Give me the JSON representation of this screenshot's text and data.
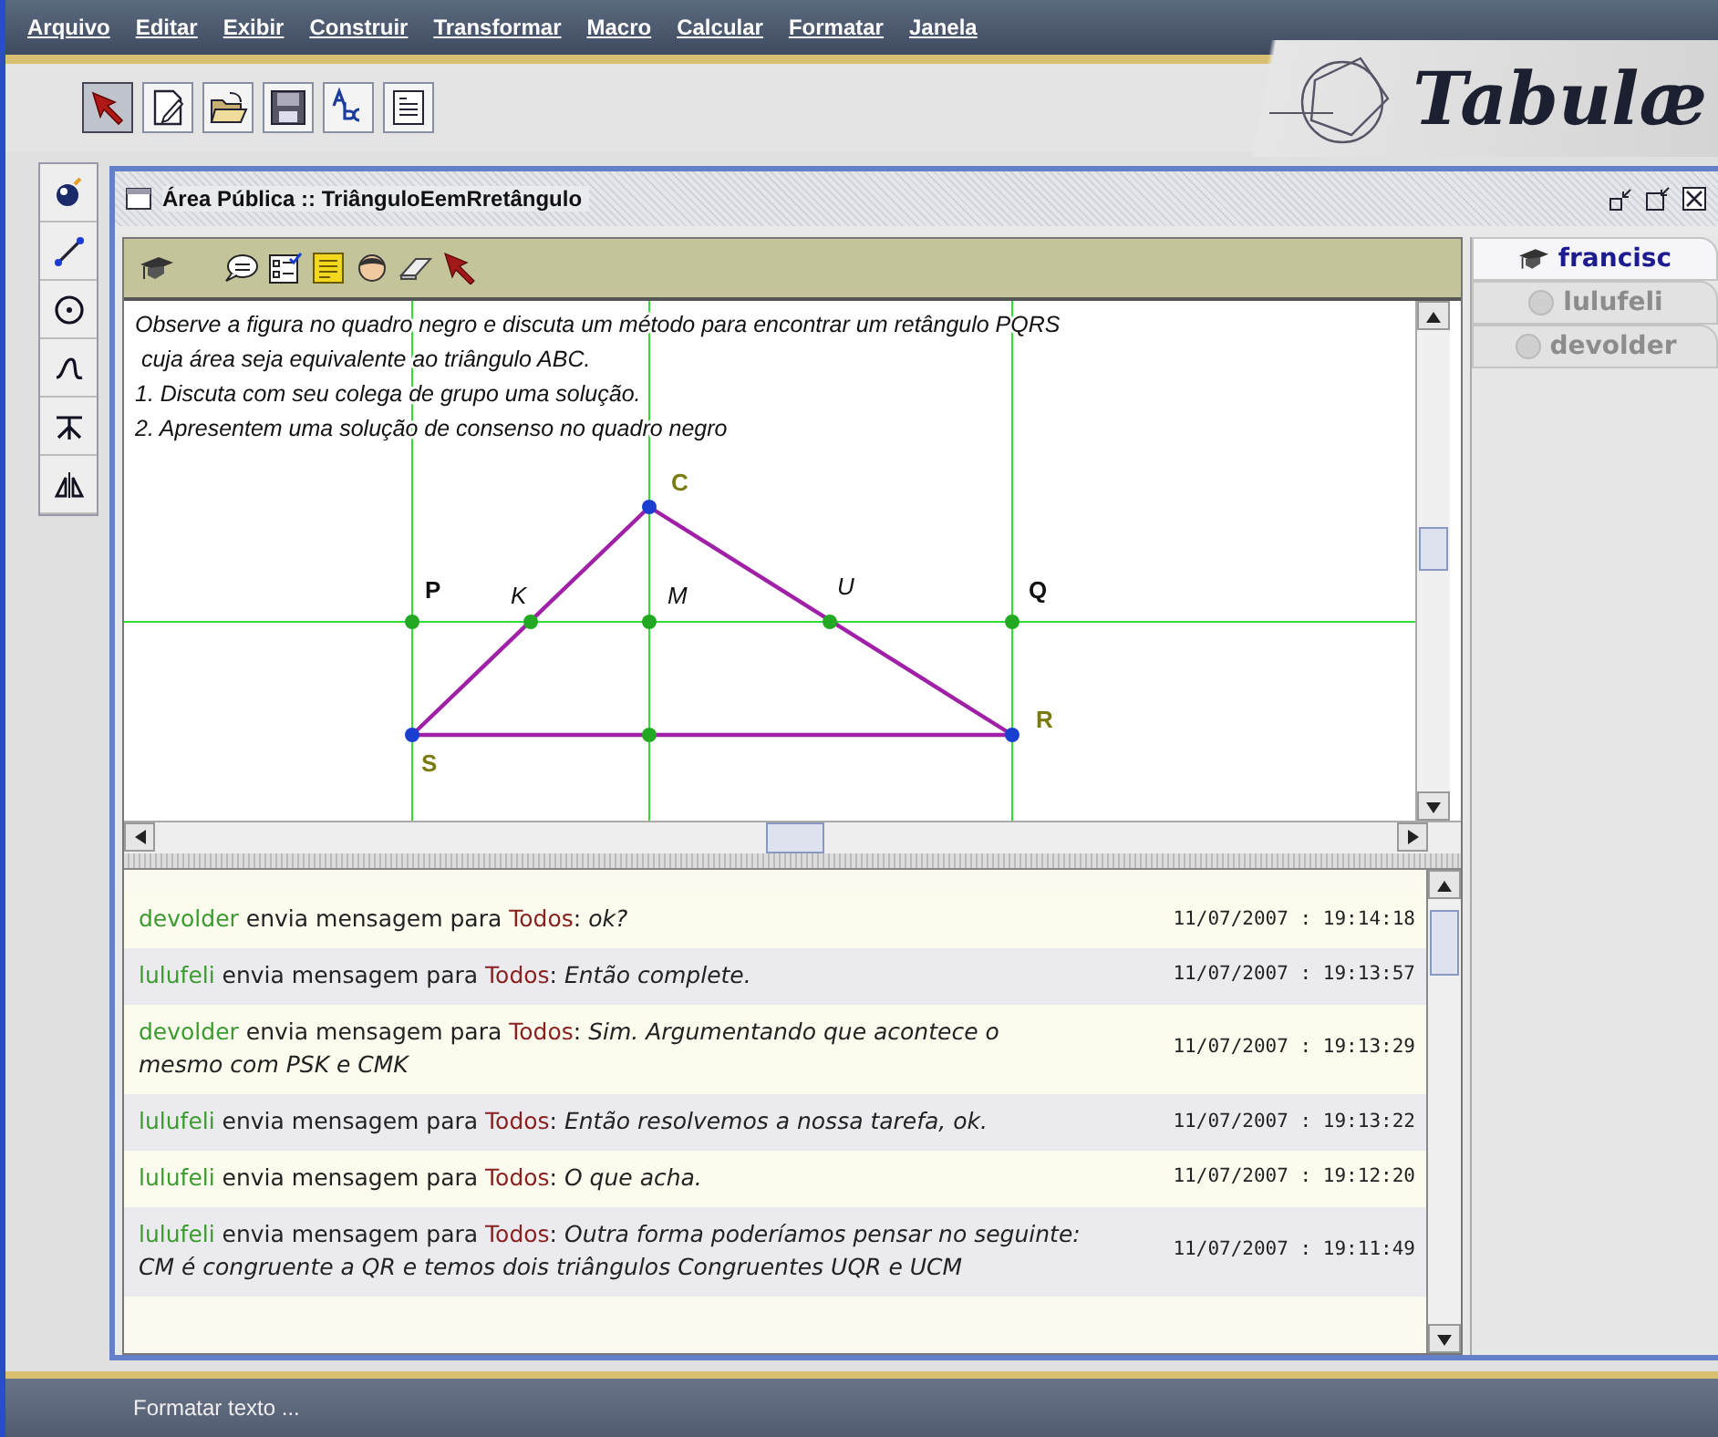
{
  "menu": [
    "Arquivo",
    "Editar",
    "Exibir",
    "Construir",
    "Transformar",
    "Macro",
    "Calcular",
    "Formatar",
    "Janela"
  ],
  "logo": "Tabulæ",
  "toolbar": [
    {
      "selected": true
    },
    {
      "selected": false
    },
    {
      "selected": false
    },
    {
      "selected": false
    },
    {
      "selected": false
    },
    {
      "selected": false
    }
  ],
  "window": {
    "title": "Área Pública :: TriânguloEemRretângulo"
  },
  "canvas": {
    "instructions": [
      "Observe a figura no quadro negro e discuta um método para encontrar um retângulo PQRS",
      " cuja área seja equivalente ao triângulo ABC.",
      "1. Discuta com seu colega de grupo uma solução.",
      "2. Apresentem uma solução de consenso no quadro negro"
    ],
    "points": [
      {
        "label": "C",
        "kind": "vertex"
      },
      {
        "label": "P",
        "kind": "corner"
      },
      {
        "label": "K",
        "kind": "intersection"
      },
      {
        "label": "M",
        "kind": "intersection"
      },
      {
        "label": "U",
        "kind": "intersection"
      },
      {
        "label": "Q",
        "kind": "corner"
      },
      {
        "label": "R",
        "kind": "vertex"
      },
      {
        "label": "S",
        "kind": "vertex"
      }
    ]
  },
  "chat": [
    {
      "sender": "devolder",
      "action": "envia mensagem para",
      "recipient": "Todos",
      "separator": ":",
      "text": "ok?",
      "time": "11/07/2007 : 19:14:18"
    },
    {
      "sender": "lulufeli",
      "action": "envia mensagem para",
      "recipient": "Todos",
      "separator": ":",
      "text": "Então complete.",
      "time": "11/07/2007 : 19:13:57"
    },
    {
      "sender": "devolder",
      "action": "envia mensagem para",
      "recipient": "Todos",
      "separator": ":",
      "text": "Sim. Argumentando que acontece o mesmo com PSK e CMK",
      "time": "11/07/2007 : 19:13:29"
    },
    {
      "sender": "lulufeli",
      "action": "envia mensagem para",
      "recipient": "Todos",
      "separator": ":",
      "text": "Então resolvemos a nossa tarefa, ok.",
      "time": "11/07/2007 : 19:13:22"
    },
    {
      "sender": "lulufeli",
      "action": "envia mensagem para",
      "recipient": "Todos",
      "separator": ":",
      "text": "O que acha.",
      "time": "11/07/2007 : 19:12:20"
    },
    {
      "sender": "lulufeli",
      "action": "envia mensagem para",
      "recipient": "Todos",
      "separator": ":",
      "text": "Outra forma poderíamos pensar no seguinte: CM é congruente a QR e temos dois triângulos Congruentes UQR e UCM",
      "time": "11/07/2007 : 19:11:49"
    }
  ],
  "users": [
    {
      "name": "francisc",
      "kind": "teacher",
      "selected": true,
      "online": true
    },
    {
      "name": "lulufeli",
      "kind": "student",
      "selected": false,
      "online": false
    },
    {
      "name": "devolder",
      "kind": "student",
      "selected": false,
      "online": false
    }
  ],
  "status_bar": "Formatar texto ..."
}
